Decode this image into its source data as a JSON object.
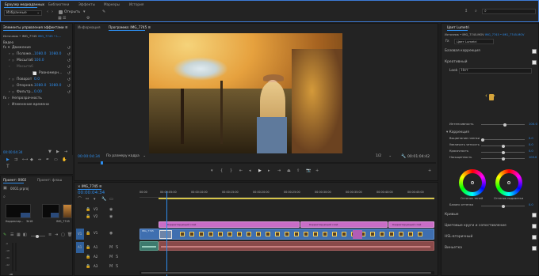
{
  "top_tabs": [
    "Браузер медиаданных",
    "Библиотеки",
    "Эффекты",
    "Маркеры",
    "История"
  ],
  "media_browser": {
    "favorites": "Избранные",
    "show_label": "Открыть"
  },
  "effect_controls": {
    "tab_title": "Элементы управления эффектами",
    "tab_menu": "≡",
    "source": "Источник • IMG_7745",
    "target": "IMG_7745 • L...",
    "video_header": "Видео",
    "motion": "Движение",
    "position_label": "Положе...",
    "position_x": "1080.0",
    "position_y": "1080.0",
    "scale_label": "Масштаб",
    "scale_value": "100.0",
    "scale_w_label": "Масштаб",
    "uniform_label": "Равномерн...",
    "rotation_label": "Поворот",
    "rotation_value": "0.0",
    "anchor_label": "Опорная...",
    "anchor_x": "1080.0",
    "anchor_y": "1080.0",
    "flicker_label": "Фильтр...",
    "flicker_value": "0.00",
    "opacity": "Непрозрачность",
    "time_remap": "Изменение времени",
    "timecode": "00:00:04:34"
  },
  "project": {
    "tab1": "Проект: 0002",
    "tab2": "Проект: флаш",
    "file": "0002.prproj",
    "items": [
      {
        "name": "Корректир...",
        "dur": "0k18"
      },
      {
        "name": "3k18",
        "dur": ""
      },
      {
        "name": "IMG_7745",
        "dur": "3:02"
      }
    ]
  },
  "info_tab": "Информация",
  "program": {
    "title": "Программа: IMG_7745",
    "tab_menu": "≡",
    "timecode_left": "00:00:04:34",
    "fit": "По размеру кадра",
    "quality": "1/2",
    "timecode_right": "00:01:04:42"
  },
  "lumetri": {
    "title": "Цвет Lumetri",
    "source": "Источник • IMG_7745.MOV",
    "target": "IMG_7745 • IMG_7745.MOV",
    "preset": "Цвет Lumetri",
    "basic": "Базовая коррекция",
    "creative": "Креативный",
    "look_label": "Look",
    "look_value": "Нет",
    "intensity_label": "Интенсивность",
    "intensity_value": "100.0",
    "correction": "Коррекция",
    "faded_label": "Выцветание пленки",
    "faded_value": "0.0",
    "sharpen_label": "Увеличить четкость",
    "sharpen_value": "0.0",
    "vibrance_label": "Красочность",
    "vibrance_value": "0.0",
    "saturation_label": "Насыщенность",
    "saturation_value": "100.0",
    "wheel1_label": "Оттенок теней",
    "wheel2_label": "Оттенок подсветки",
    "balance_label": "Баланс оттенка",
    "balance_value": "0.0",
    "sections": [
      "Кривые",
      "Цветовые круги и сопоставление",
      "HSL-вторичный",
      "Виньетка"
    ]
  },
  "timeline": {
    "title": "IMG_7745",
    "timecode": "00:00:04:34",
    "ruler": [
      "00:00",
      "00:00:05:00",
      "00:00:10:00",
      "00:00:15:00",
      "00:00:20:00",
      "00:00:25:00",
      "00:00:30:00",
      "00:00:35:00",
      "00:00:40:00",
      "00:00:45:00"
    ],
    "tracks_video": [
      "V3",
      "V2",
      "V1"
    ],
    "tracks_audio": [
      "A1",
      "A2",
      "A3"
    ],
    "adj_label_1": "Корректирующий слой",
    "adj_label_2": "Корректирующий слой",
    "adj_label_3": "Корректирующий слой",
    "v1_label": "IMG_7745",
    "audio_meter": [
      "-6",
      "-12",
      "-18",
      "-24",
      "-30",
      "-36",
      "-42",
      "-48",
      "-54"
    ],
    "meter_db": [
      "-dB",
      "-dB"
    ]
  },
  "colors": {
    "accent": "#2d8ceb",
    "adjustment": "#c96dc7",
    "video_clip": "#3f6fb0",
    "audio_clip": "#3d7a6e",
    "playhead": "#2d8ceb"
  }
}
